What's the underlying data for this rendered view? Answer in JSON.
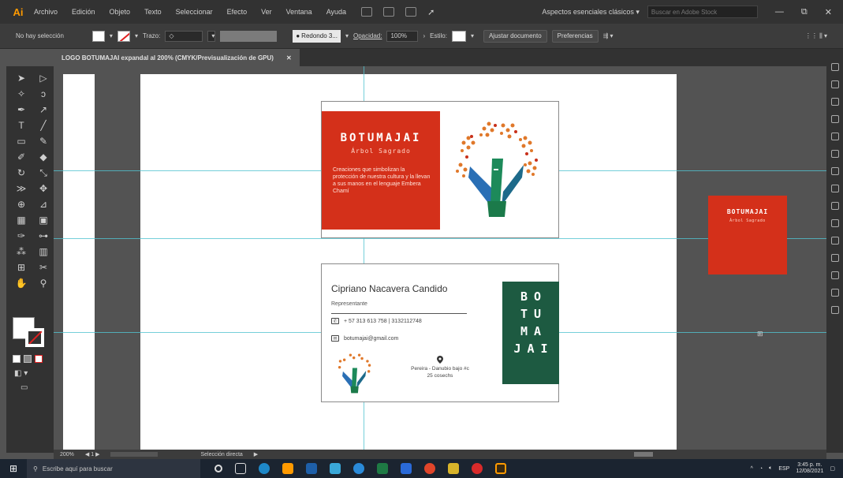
{
  "menubar": {
    "app_logo": "Ai",
    "items": [
      "Archivo",
      "Edición",
      "Objeto",
      "Texto",
      "Seleccionar",
      "Efecto",
      "Ver",
      "Ventana",
      "Ayuda"
    ],
    "workspace": "Aspectos esenciales clásicos",
    "search_placeholder": "Buscar en Adobe Stock",
    "window_controls": [
      "—",
      "⧉",
      "✕"
    ]
  },
  "controlbar": {
    "selection_label": "No hay selección",
    "stroke_label": "Trazo:",
    "brush_label": "Redondo 3...",
    "opacity_label": "Opacidad:",
    "opacity_value": "100%",
    "style_label": "Estilo:",
    "doc_setup_button": "Ajustar documento",
    "prefs_button": "Preferencias"
  },
  "doctab": {
    "title": "LOGO BOTUMAJAI expandal al 200% (CMYK/Previsualización de GPU)",
    "close": "✕"
  },
  "front_card": {
    "brand": "BOTUMAJAI",
    "subtitle": "Árbol Sagrado",
    "tagline": "Creaciones que simbolizan la protección de nuestra cultura y la llevan a sus manos en el lenguaje Embera Chamí"
  },
  "back_card": {
    "name": "Cipriano Nacavera Candido",
    "role": "Representante",
    "phone": "+ 57 313 613 758   |   3132112748",
    "email": "botumajai@gmail.com",
    "address_line1": "Pereira - Danubio bajo #c",
    "address_line2": "25 cosechs",
    "vertical_brand": [
      "BO",
      "TU",
      "MA",
      "JAI"
    ]
  },
  "pasteboard": {
    "brand": "BOTUMAJAI",
    "subtitle": "Árbol Sagrado"
  },
  "statusbar": {
    "zoom": "200%",
    "page_nav": "◀  1  ▶",
    "tool": "Selección directa"
  },
  "taskbar": {
    "search_placeholder": "Escribe aquí para buscar",
    "time": "3:45 p. m.",
    "date": "12/08/2021",
    "lang": "ESP"
  },
  "colors": {
    "brand_red": "#d4301a",
    "brand_green": "#1d5a41",
    "guide_cyan": "#52c3cf"
  }
}
